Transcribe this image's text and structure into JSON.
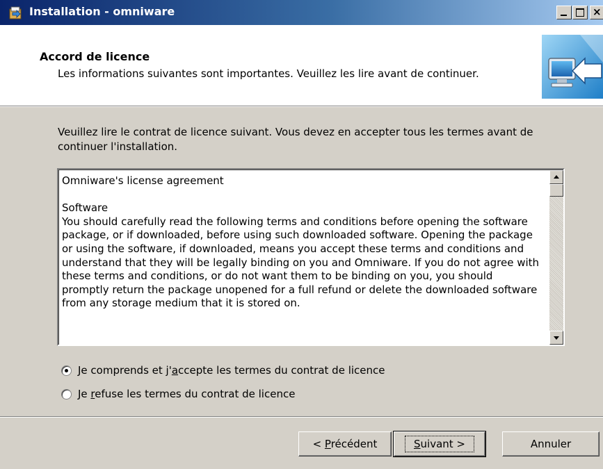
{
  "window": {
    "title": "Installation - omniware"
  },
  "header": {
    "title": "Accord de licence",
    "subtitle": "Les informations suivantes sont importantes. Veuillez les lire avant de continuer."
  },
  "intro": {
    "text": "Veuillez lire le contrat de licence suivant. Vous devez en accepter tous les termes avant de continuer l'installation."
  },
  "license": {
    "text": "Omniware's license agreement\n\nSoftware\nYou should carefully read the following terms and conditions before opening the software package, or if downloaded, before using such downloaded software. Opening the package or using the software, if downloaded, means you accept these terms and conditions and understand that they will be legally binding on you and Omniware. If you do not agree with these terms and conditions, or do not want them to be binding on you, you should promptly return the package unopened for a full refund or delete the downloaded software from any storage medium that it is stored on."
  },
  "options": {
    "accept_prefix": "Je comprends et j'",
    "accept_mnemonic": "a",
    "accept_suffix": "ccepte les termes du contrat de licence",
    "accept_checked": true,
    "refuse_prefix": "Je ",
    "refuse_mnemonic": "r",
    "refuse_suffix": "efuse les termes du contrat de licence",
    "refuse_checked": false
  },
  "buttons": {
    "prev_prefix": "< ",
    "prev_mnemonic": "P",
    "prev_suffix": "récédent",
    "next_mnemonic": "S",
    "next_suffix": "uivant >",
    "cancel": "Annuler"
  },
  "colors": {
    "titlebar_start": "#0a246a",
    "titlebar_end": "#a6caf0",
    "face": "#d4d0c8"
  },
  "icons": {
    "app": "installer-icon",
    "wizard": "computer-install-icon"
  }
}
